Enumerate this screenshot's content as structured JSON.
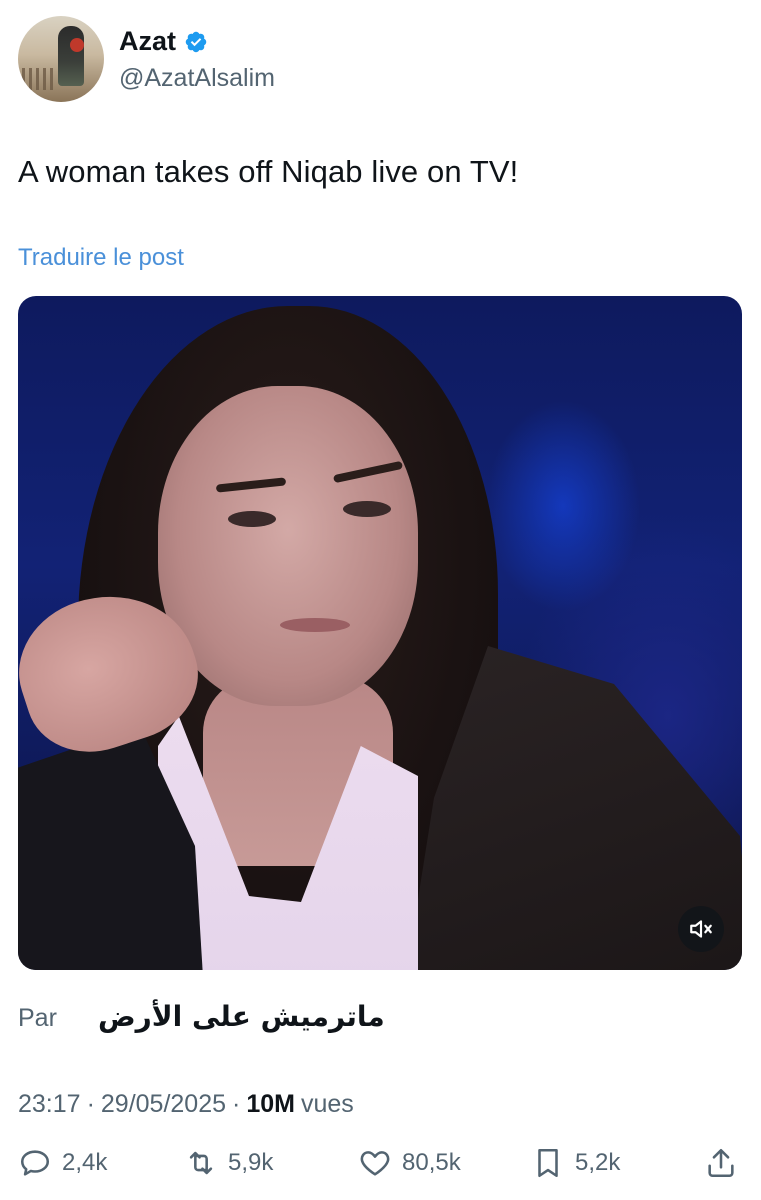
{
  "author": {
    "name": "Azat",
    "handle": "@AzatAlsalim",
    "verified": true,
    "verified_color": "#1d9bf0"
  },
  "post": {
    "text": "A woman takes off Niqab live on TV!",
    "translate_label": "Traduire le post"
  },
  "media": {
    "type": "video",
    "mute_icon": "speaker-muted-icon"
  },
  "attribution": {
    "label": "Par",
    "name": "ماترميش على الأرض"
  },
  "meta": {
    "time": "23:17",
    "separator": "·",
    "date": "29/05/2025",
    "views_count": "10M",
    "views_label": "vues"
  },
  "actions": {
    "replies": "2,4k",
    "reposts": "5,9k",
    "likes": "80,5k",
    "bookmarks": "5,2k"
  },
  "colors": {
    "text": "#0f1419",
    "secondary": "#536471",
    "link": "#4a90d9"
  }
}
